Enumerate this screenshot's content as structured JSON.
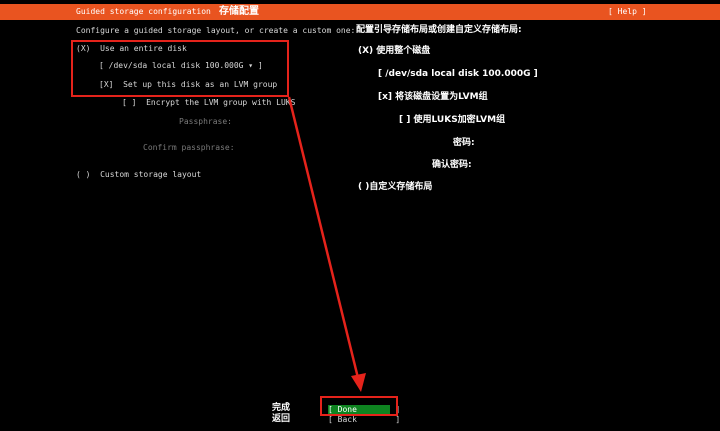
{
  "header": {
    "title": "Guided storage configuration",
    "title_zh": "存储配置",
    "help": "[ Help ]"
  },
  "left": {
    "intro": "Configure a guided storage layout, or create a custom one:",
    "use_entire_disk": "(X)  Use an entire disk",
    "disk_select": "[ /dev/sda local disk 100.000G ▾ ]",
    "lvm_group": "[X]  Set up this disk as an LVM group",
    "encrypt": "[ ]  Encrypt the LVM group with LUKS",
    "passphrase": "Passphrase:",
    "confirm_passphrase": "Confirm passphrase:",
    "custom_layout": "( )  Custom storage layout"
  },
  "right": {
    "intro": "配置引导存储布局或创建自定义存储布局:",
    "use_entire_disk": "(X) 使用整个磁盘",
    "disk": "[ /dev/sda local disk 100.000G ]",
    "lvm_group": "[x] 将该磁盘设置为LVM组",
    "encrypt": "[ ] 使用LUKS加密LVM组",
    "passphrase": "密码:",
    "confirm_passphrase": "确认密码:",
    "custom_layout": "( )自定义存储布局"
  },
  "footer": {
    "done_zh": "完成",
    "back_zh": "返回",
    "done": "[ Done        ]",
    "back": "[ Back        ]"
  },
  "colors": {
    "header_bg": "#e95420",
    "done_bg": "#0e8420",
    "annotation_red": "#e5231b"
  }
}
